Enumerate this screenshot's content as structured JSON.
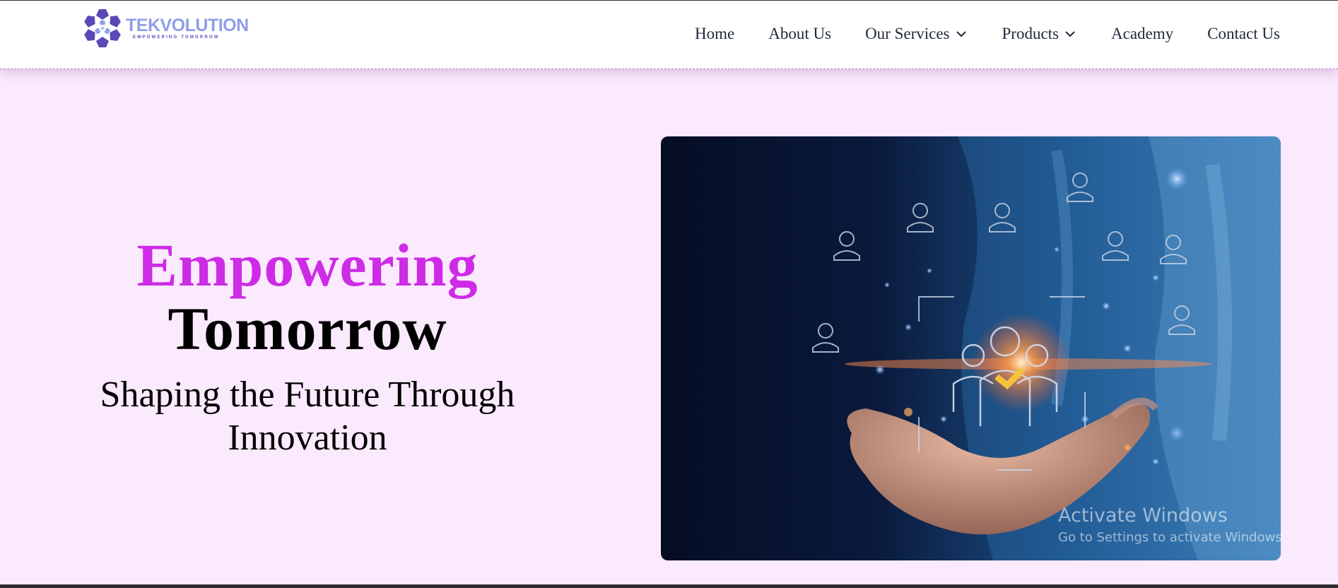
{
  "brand": {
    "name": "TEKVOLUTION",
    "tagline": "EMPOWERING TOMORROW",
    "primary_color": "#cd2be6",
    "logo_color": "#5a49b4"
  },
  "nav": {
    "items": [
      {
        "label": "Home",
        "has_dropdown": false
      },
      {
        "label": "About Us",
        "has_dropdown": false
      },
      {
        "label": "Our Services",
        "has_dropdown": true
      },
      {
        "label": "Products",
        "has_dropdown": true
      },
      {
        "label": "Academy",
        "has_dropdown": false
      },
      {
        "label": "Contact Us",
        "has_dropdown": false
      }
    ]
  },
  "hero": {
    "title_line1": "Empowering",
    "title_line2": "Tomorrow",
    "subtitle": "Shaping the Future Through Innovation",
    "image_icon": "hand-holding-network-people-image"
  },
  "os_overlay": {
    "title": "Activate Windows",
    "message": "Go to Settings to activate Windows."
  }
}
